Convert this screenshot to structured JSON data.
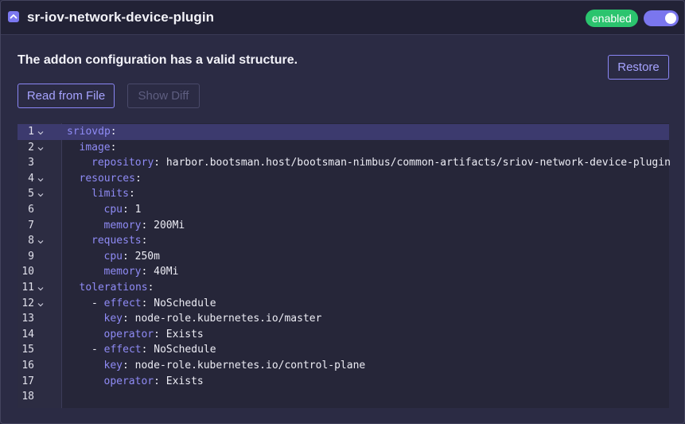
{
  "header": {
    "title": "sr-iov-network-device-plugin",
    "badge": "enabled",
    "toggle_on": true
  },
  "status_message": "The addon configuration has a valid structure.",
  "buttons": {
    "restore": "Restore",
    "read_from_file": "Read from File",
    "show_diff": "Show Diff"
  },
  "editor": {
    "active_line": 1,
    "lines": [
      {
        "n": "1",
        "fold": true,
        "indent": 0,
        "dash": false,
        "key": "sriovdp",
        "sep": ":",
        "value": ""
      },
      {
        "n": "2",
        "fold": true,
        "indent": 1,
        "dash": false,
        "key": "image",
        "sep": ":",
        "value": ""
      },
      {
        "n": "3",
        "fold": false,
        "indent": 2,
        "dash": false,
        "key": "repository",
        "sep": ":",
        "value": " harbor.bootsman.host/bootsman-nimbus/common-artifacts/sriov-network-device-plugin"
      },
      {
        "n": "4",
        "fold": true,
        "indent": 1,
        "dash": false,
        "key": "resources",
        "sep": ":",
        "value": ""
      },
      {
        "n": "5",
        "fold": true,
        "indent": 2,
        "dash": false,
        "key": "limits",
        "sep": ":",
        "value": ""
      },
      {
        "n": "6",
        "fold": false,
        "indent": 3,
        "dash": false,
        "key": "cpu",
        "sep": ":",
        "value": " 1"
      },
      {
        "n": "7",
        "fold": false,
        "indent": 3,
        "dash": false,
        "key": "memory",
        "sep": ":",
        "value": " 200Mi"
      },
      {
        "n": "8",
        "fold": true,
        "indent": 2,
        "dash": false,
        "key": "requests",
        "sep": ":",
        "value": ""
      },
      {
        "n": "9",
        "fold": false,
        "indent": 3,
        "dash": false,
        "key": "cpu",
        "sep": ":",
        "value": " 250m"
      },
      {
        "n": "10",
        "fold": false,
        "indent": 3,
        "dash": false,
        "key": "memory",
        "sep": ":",
        "value": " 40Mi"
      },
      {
        "n": "11",
        "fold": true,
        "indent": 1,
        "dash": false,
        "key": "tolerations",
        "sep": ":",
        "value": ""
      },
      {
        "n": "12",
        "fold": true,
        "indent": 2,
        "dash": true,
        "key": "effect",
        "sep": ":",
        "value": " NoSchedule"
      },
      {
        "n": "13",
        "fold": false,
        "indent": 3,
        "dash": false,
        "key": "key",
        "sep": ":",
        "value": " node-role.kubernetes.io/master"
      },
      {
        "n": "14",
        "fold": false,
        "indent": 3,
        "dash": false,
        "key": "operator",
        "sep": ":",
        "value": " Exists"
      },
      {
        "n": "15",
        "fold": false,
        "indent": 2,
        "dash": true,
        "key": "effect",
        "sep": ":",
        "value": " NoSchedule"
      },
      {
        "n": "16",
        "fold": false,
        "indent": 3,
        "dash": false,
        "key": "key",
        "sep": ":",
        "value": " node-role.kubernetes.io/control-plane"
      },
      {
        "n": "17",
        "fold": false,
        "indent": 3,
        "dash": false,
        "key": "operator",
        "sep": ":",
        "value": " Exists"
      },
      {
        "n": "18",
        "fold": false,
        "indent": 0,
        "dash": false,
        "key": "",
        "sep": "",
        "value": ""
      }
    ]
  },
  "colors": {
    "accent": "#8a86f5",
    "badge": "#2bc46e",
    "yaml_key": "#8f8bf5"
  }
}
